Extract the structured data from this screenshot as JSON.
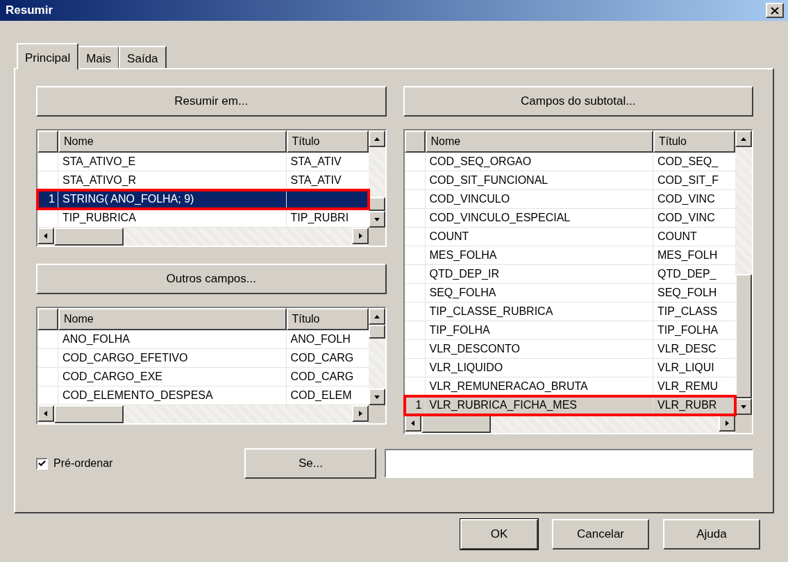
{
  "window": {
    "title": "Resumir"
  },
  "tabs": [
    {
      "label": "Principal",
      "selected": true
    },
    {
      "label": "Mais",
      "selected": false
    },
    {
      "label": "Saída",
      "selected": false
    }
  ],
  "panels": [
    {
      "button": "Resumir em...",
      "grid": {
        "columns": [
          "Nome",
          "Título"
        ],
        "focused": true,
        "rows": [
          {
            "nome": "STA_ATIVO_E",
            "titulo": "STA_ATIV",
            "selected": false,
            "highlighted": false
          },
          {
            "nome": "STA_ATIVO_R",
            "titulo": "STA_ATIV",
            "selected": false,
            "highlighted": false
          },
          {
            "marker": "1",
            "nome": "STRING( ANO_FOLHA; 9)",
            "selected": true,
            "highlighted": true
          },
          {
            "nome": "TIP_RUBRICA",
            "titulo": "TIP_RUBRI",
            "selected": false,
            "highlighted": false
          }
        ]
      }
    },
    {
      "button": "Outros campos...",
      "grid": {
        "columns": [
          "Nome",
          "Título"
        ],
        "rows": [
          {
            "nome": "ANO_FOLHA",
            "titulo": "ANO_FOLH",
            "selected": false,
            "highlighted": false
          },
          {
            "nome": "COD_CARGO_EFETIVO",
            "titulo": "COD_CARG",
            "selected": false,
            "highlighted": false
          },
          {
            "nome": "COD_CARGO_EXE",
            "titulo": "COD_CARG",
            "selected": false,
            "highlighted": false
          },
          {
            "nome": "COD_ELEMENTO_DESPESA",
            "titulo": "COD_ELEM",
            "selected": false,
            "highlighted": false
          }
        ]
      }
    },
    {
      "button": "Campos do subtotal...",
      "grid": {
        "columns": [
          "Nome",
          "Título"
        ],
        "focused": false,
        "rows": [
          {
            "nome": "COD_SEQ_ORGAO",
            "titulo": "COD_SEQ_",
            "selected": false,
            "highlighted": false
          },
          {
            "nome": "COD_SIT_FUNCIONAL",
            "titulo": "COD_SIT_F",
            "selected": false,
            "highlighted": false
          },
          {
            "nome": "COD_VINCULO",
            "titulo": "COD_VINC",
            "selected": false,
            "highlighted": false
          },
          {
            "nome": "COD_VINCULO_ESPECIAL",
            "titulo": "COD_VINC",
            "selected": false,
            "highlighted": false
          },
          {
            "nome": "COUNT",
            "titulo": "COUNT",
            "selected": false,
            "highlighted": false
          },
          {
            "nome": "MES_FOLHA",
            "titulo": "MES_FOLH",
            "selected": false,
            "highlighted": false
          },
          {
            "nome": "QTD_DEP_IR",
            "titulo": "QTD_DEP_",
            "selected": false,
            "highlighted": false
          },
          {
            "nome": "SEQ_FOLHA",
            "titulo": "SEQ_FOLH",
            "selected": false,
            "highlighted": false
          },
          {
            "nome": "TIP_CLASSE_RUBRICA",
            "titulo": "TIP_CLASS",
            "selected": false,
            "highlighted": false
          },
          {
            "nome": "TIP_FOLHA",
            "titulo": "TIP_FOLHA",
            "selected": false,
            "highlighted": false
          },
          {
            "nome": "VLR_DESCONTO",
            "titulo": "VLR_DESC",
            "selected": false,
            "highlighted": false
          },
          {
            "nome": "VLR_LIQUIDO",
            "titulo": "VLR_LIQUI",
            "selected": false,
            "highlighted": false
          },
          {
            "nome": "VLR_REMUNERACAO_BRUTA",
            "titulo": "VLR_REMU",
            "selected": false,
            "highlighted": false
          },
          {
            "marker": "1",
            "nome": "VLR_RUBRICA_FICHA_MES",
            "titulo": "VLR_RUBR",
            "selected": true,
            "highlighted": true
          }
        ]
      }
    }
  ],
  "preorder": {
    "label": "Pré-ordenar",
    "checked": true
  },
  "condition_button": "Se...",
  "buttons": [
    {
      "label": "OK",
      "default": true
    },
    {
      "label": "Cancelar",
      "default": false
    },
    {
      "label": "Ajuda",
      "default": false
    }
  ]
}
